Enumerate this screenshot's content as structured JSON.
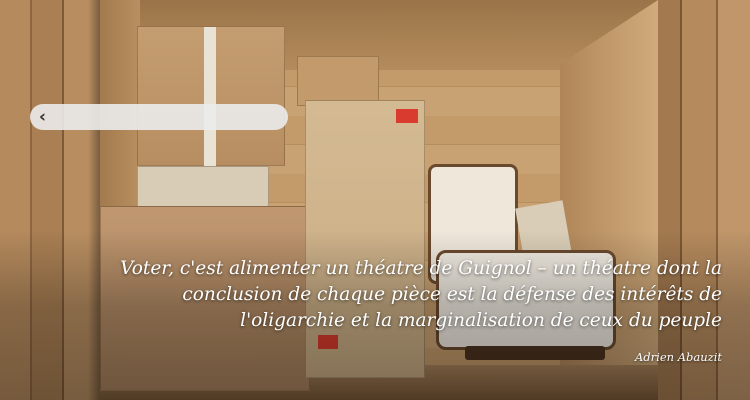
{
  "navigation": {
    "back_icon": "chevron-left-icon",
    "back_glyph": "‹"
  },
  "quote": {
    "text": "Voter, c'est alimenter un théatre de Guignol – un théatre dont la conclusion de chaque pièce est la défense des intérêts de l'oligarchie et la marginalisation de ceux du peuple",
    "author": "Adrien Abauzit"
  },
  "colors": {
    "quote_text": "#ffffff",
    "pill_background": "#ebebeb",
    "label_red": "#d93b2e"
  }
}
